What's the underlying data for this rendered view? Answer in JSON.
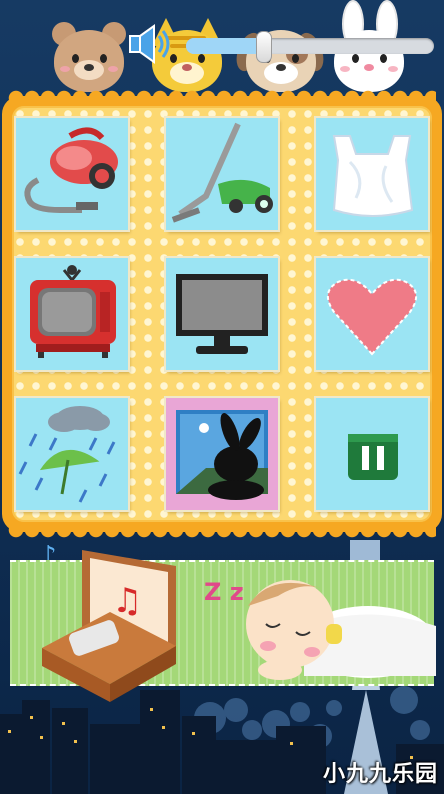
{
  "header": {
    "animals": [
      {
        "name": "bear-icon"
      },
      {
        "name": "cat-icon"
      },
      {
        "name": "dog-icon"
      },
      {
        "name": "rabbit-icon"
      }
    ],
    "volume": {
      "icon": "speaker-icon",
      "level": 0.31
    }
  },
  "grid": {
    "tiles": [
      {
        "name": "vacuum-cleaner-canister-icon"
      },
      {
        "name": "vacuum-cleaner-stick-icon"
      },
      {
        "name": "plastic-bag-icon"
      },
      {
        "name": "retro-tv-static-icon"
      },
      {
        "name": "monitor-static-icon"
      },
      {
        "name": "heart-icon"
      },
      {
        "name": "rain-umbrella-icon"
      },
      {
        "name": "window-rabbit-icon"
      },
      {
        "name": "pause-icon"
      }
    ]
  },
  "scene": {
    "music_box": "music-box-icon",
    "sleeping_baby": "sleeping-baby-icon",
    "snore_text": "Z z"
  },
  "watermark": "小九九乐园",
  "colors": {
    "frame": "#f6a822",
    "tile_bg": "#9be4f3",
    "pause_green": "#1f7a3b",
    "mat_green": "#a4d878"
  }
}
